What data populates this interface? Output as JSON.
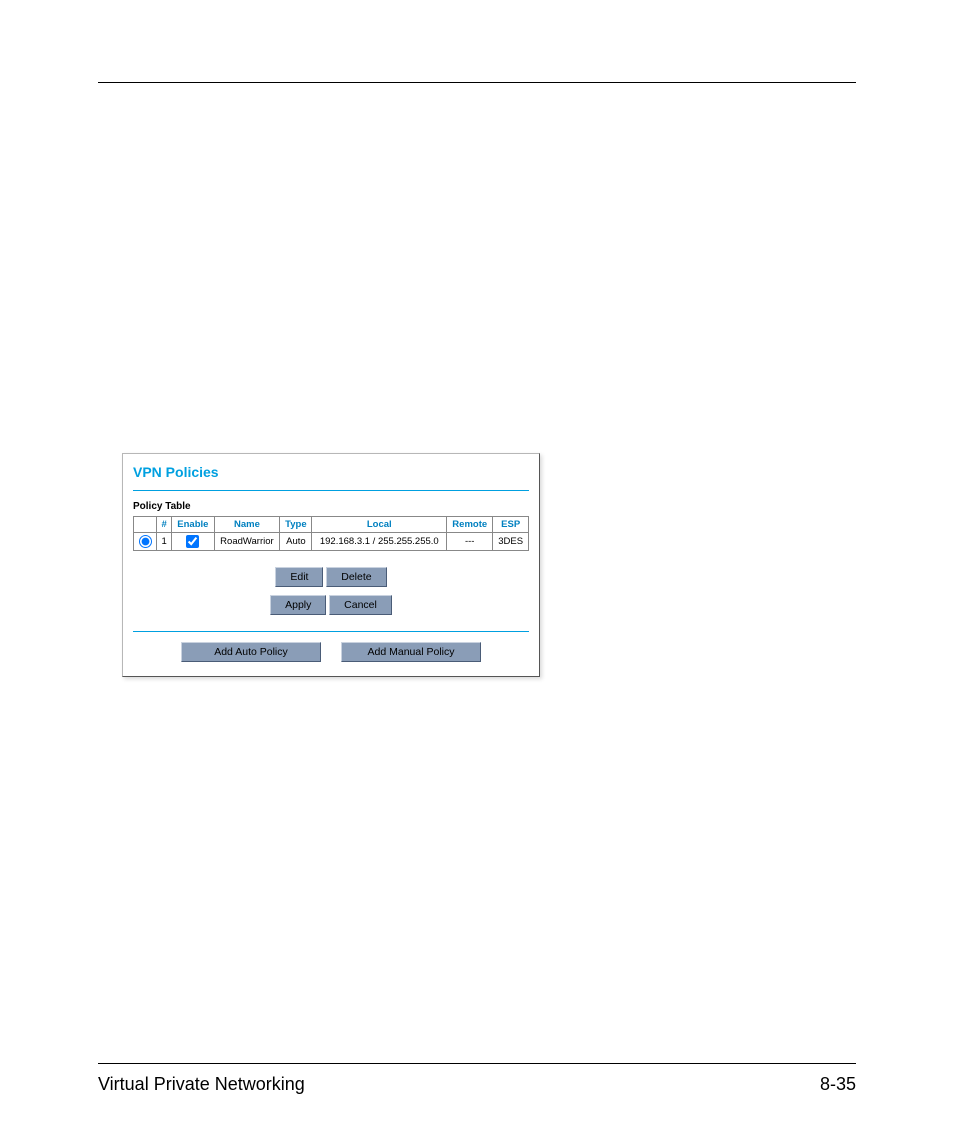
{
  "panel": {
    "title": "VPN Policies",
    "section_label": "Policy Table",
    "headers": {
      "blank": "",
      "num": "#",
      "enable": "Enable",
      "name": "Name",
      "type": "Type",
      "local": "Local",
      "remote": "Remote",
      "esp": "ESP"
    },
    "row": {
      "num": "1",
      "name": "RoadWarrior",
      "type": "Auto",
      "local": "192.168.3.1 / 255.255.255.0",
      "remote": "---",
      "esp": "3DES"
    },
    "buttons": {
      "edit": "Edit",
      "delete": "Delete",
      "apply": "Apply",
      "cancel": "Cancel",
      "add_auto": "Add Auto Policy",
      "add_manual": "Add Manual Policy"
    }
  },
  "footer": {
    "left": "Virtual Private Networking",
    "right": "8-35"
  }
}
